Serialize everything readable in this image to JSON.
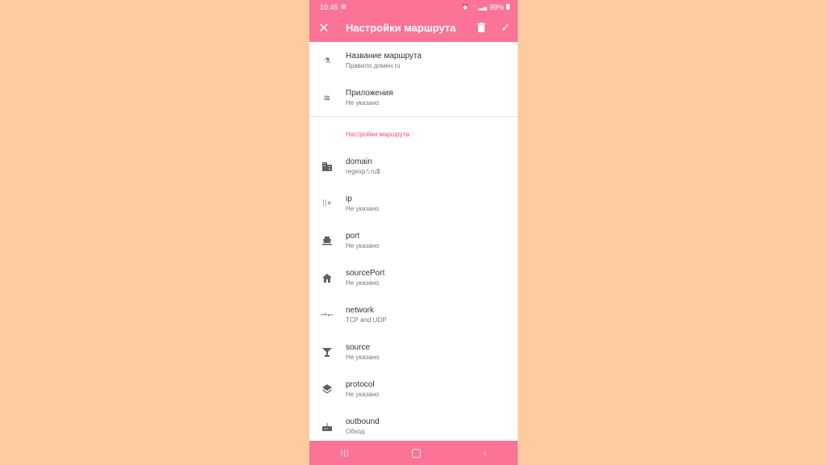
{
  "status_bar": {
    "time": "10:45",
    "battery": "99%",
    "icons": [
      "blocked-icon",
      "alarm-icon",
      "wifi-icon",
      "volte-icon",
      "signal-icon",
      "battery-icon"
    ]
  },
  "app_bar": {
    "title": "Настройки маршрута",
    "close_icon": "close-icon",
    "delete_icon": "trash-icon",
    "confirm_icon": "check-icon"
  },
  "top_items": [
    {
      "icon": "rule-name-icon",
      "label": "Название маршрута",
      "value": "Правило домен ru"
    },
    {
      "icon": "apps-icon",
      "label": "Приложения",
      "value": "Не указано"
    }
  ],
  "section_header": "Настройки маршрута",
  "settings_items": [
    {
      "icon": "domain-icon",
      "label": "domain",
      "value": "regexp:\\.ru$"
    },
    {
      "icon": "ip-icon",
      "label": "ip",
      "value": "Не указано"
    },
    {
      "icon": "port-icon",
      "label": "port",
      "value": "Не указано"
    },
    {
      "icon": "home-icon",
      "label": "sourcePort",
      "value": "Не указано"
    },
    {
      "icon": "network-icon",
      "label": "network",
      "value": "TCP and UDP"
    },
    {
      "icon": "source-icon",
      "label": "source",
      "value": "Не указано"
    },
    {
      "icon": "layers-icon",
      "label": "protocol",
      "value": "Не указано"
    },
    {
      "icon": "router-icon",
      "label": "outbound",
      "value": "Обход"
    }
  ],
  "nav_bar": [
    "recents-button",
    "home-button",
    "back-button"
  ],
  "colors": {
    "accent": "#fc7495",
    "section_header": "#fc4a86",
    "background": "#fecba0"
  }
}
